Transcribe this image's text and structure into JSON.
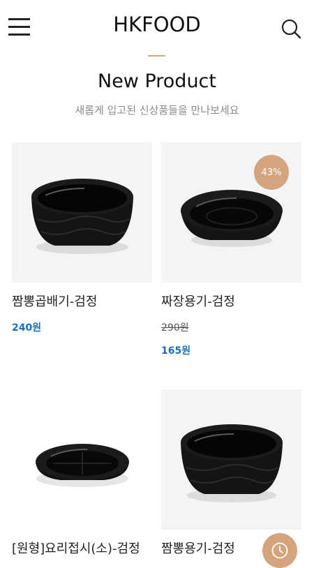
{
  "header": {
    "logo": "HKFOOD"
  },
  "section": {
    "title": "New Product",
    "subtitle": "새롭게 입고된 신상품들을 만나보세요"
  },
  "products": [
    {
      "name": "짬뽕곱배기-검정",
      "price": "240원"
    },
    {
      "name": "짜장용기-검정",
      "original_price": "290원",
      "price": "165원",
      "discount": "43%"
    },
    {
      "name": "[원형]요리접시(소)-검정"
    },
    {
      "name": "짬뽕용기-검정"
    }
  ],
  "colors": {
    "accent": "#d4a47c",
    "price": "#1a6fb8",
    "thumb_bg": "#f4f4f4"
  },
  "icons": {
    "menu": "hamburger-icon",
    "search": "search-icon",
    "floating": "clock-icon"
  }
}
